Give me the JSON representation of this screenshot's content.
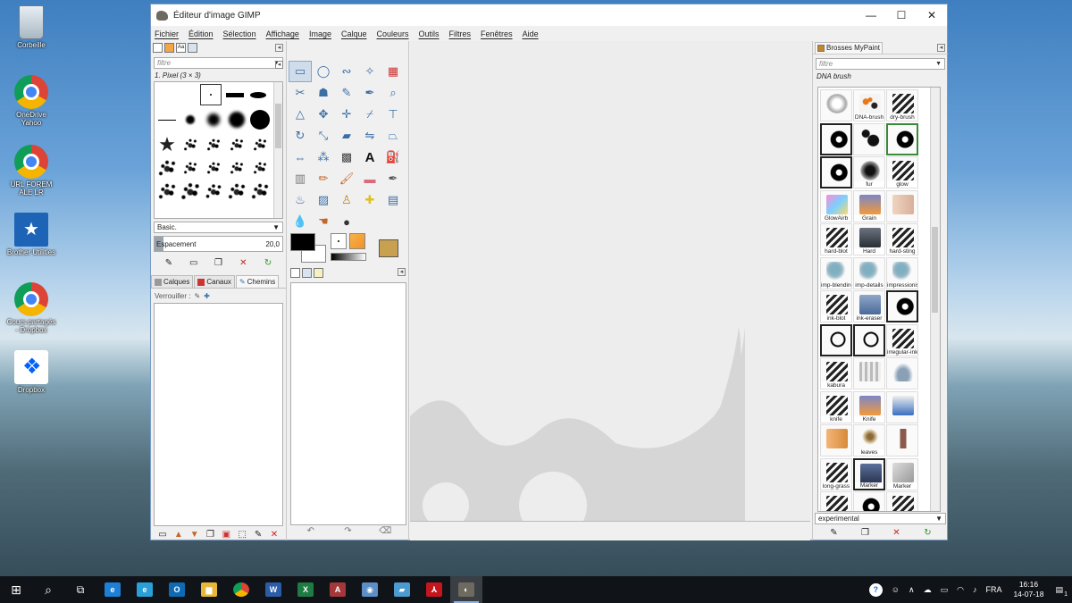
{
  "desktop": {
    "icons": [
      {
        "label": "Corbeille",
        "icon": "recycle-bin-icon"
      },
      {
        "label": "OneDrive Yahoo",
        "icon": "chrome-icon"
      },
      {
        "label": "URL FOREM ALE LR",
        "icon": "chrome-icon"
      },
      {
        "label": "Brother Utilities",
        "icon": "brother-icon"
      },
      {
        "label": "Cours partagés - Dropbox",
        "icon": "chrome-icon"
      },
      {
        "label": "Dropbox",
        "icon": "dropbox-icon"
      }
    ]
  },
  "window": {
    "title": "Éditeur d'image GIMP",
    "minimize": "—",
    "maximize": "☐",
    "close": "✕"
  },
  "menu": [
    "Fichier",
    "Édition",
    "Sélection",
    "Affichage",
    "Image",
    "Calque",
    "Couleurs",
    "Outils",
    "Filtres",
    "Fenêtres",
    "Aide"
  ],
  "brushes_panel": {
    "filter_placeholder": "filtre",
    "current_brush": "1. Pixel (3 × 3)",
    "preset": "Basic.",
    "spacing_label": "Espacement",
    "spacing_value": "20,0",
    "spacing_fraction": 0.07
  },
  "layers_panel": {
    "tabs": [
      "Calques",
      "Canaux",
      "Chemins"
    ],
    "lock_label": "Verrouiller :"
  },
  "mypaint_panel": {
    "tab_label": "Brosses MyPaint",
    "filter_placeholder": "filtre",
    "current_brush": "DNA brush",
    "tag": "experimental",
    "brushes": [
      {
        "label": "",
        "style": "swirl-gray"
      },
      {
        "label": "DNA-brush",
        "style": "dna"
      },
      {
        "label": "dry-brush",
        "style": "scribble"
      },
      {
        "label": "",
        "style": "swirl-black"
      },
      {
        "label": "",
        "style": "blobs"
      },
      {
        "label": "",
        "style": "swirl-black"
      },
      {
        "label": "",
        "style": "swirl-black"
      },
      {
        "label": "fur",
        "style": "fuzzy"
      },
      {
        "label": "glow",
        "style": "scribble"
      },
      {
        "label": "GlowAirb",
        "style": "glow"
      },
      {
        "label": "Grain",
        "style": "blend-grain"
      },
      {
        "label": "",
        "style": "finger"
      },
      {
        "label": "hard-blot",
        "style": "scribble"
      },
      {
        "label": "Hard",
        "style": "eraser-hard"
      },
      {
        "label": "hard-sting",
        "style": "scribble"
      },
      {
        "label": "imp-blending",
        "style": "teal"
      },
      {
        "label": "imp-details",
        "style": "teal"
      },
      {
        "label": "impressionism",
        "style": "teal"
      },
      {
        "label": "ink-blot",
        "style": "scribble"
      },
      {
        "label": "ink-eraser",
        "style": "eraser-ink"
      },
      {
        "label": "",
        "style": "swirl-black"
      },
      {
        "label": "",
        "style": "swirl-thin"
      },
      {
        "label": "",
        "style": "swirl-thin"
      },
      {
        "label": "irregular-ink",
        "style": "scribble"
      },
      {
        "label": "kabura",
        "style": "scribble"
      },
      {
        "label": "",
        "style": "pencils"
      },
      {
        "label": "",
        "style": "drop"
      },
      {
        "label": "knife",
        "style": "scribble"
      },
      {
        "label": "Knife",
        "style": "blend-knife"
      },
      {
        "label": "",
        "style": "blue-tool"
      },
      {
        "label": "",
        "style": "orange-stroke"
      },
      {
        "label": "leaves",
        "style": "tree"
      },
      {
        "label": "",
        "style": "bottle"
      },
      {
        "label": "long-grass",
        "style": "scribble"
      },
      {
        "label": "Marker",
        "style": "ink-marker"
      },
      {
        "label": "Marker",
        "style": "marker-hand"
      },
      {
        "label": "",
        "style": "scribble"
      },
      {
        "label": "",
        "style": "swirl-black"
      },
      {
        "label": "",
        "style": "scribble"
      }
    ]
  },
  "taskbar": {
    "apps": [
      {
        "name": "edge",
        "glyph": "e",
        "color": "#1e7fd6"
      },
      {
        "name": "internet-explorer",
        "glyph": "e",
        "color": "#2a9fd8"
      },
      {
        "name": "outlook",
        "glyph": "O",
        "color": "#0f6ab4"
      },
      {
        "name": "file-explorer",
        "glyph": "▆",
        "color": "#e8b73a"
      },
      {
        "name": "chrome",
        "glyph": "",
        "color": "#db4437"
      },
      {
        "name": "word",
        "glyph": "W",
        "color": "#2b5ca8"
      },
      {
        "name": "excel",
        "glyph": "X",
        "color": "#1f7a44"
      },
      {
        "name": "access",
        "glyph": "A",
        "color": "#a4373a"
      },
      {
        "name": "app-generic",
        "glyph": "◉",
        "color": "#5c8fc7"
      },
      {
        "name": "app-blue",
        "glyph": "▰",
        "color": "#4b9ad0"
      },
      {
        "name": "acrobat",
        "glyph": "⅄",
        "color": "#c4161c"
      },
      {
        "name": "gimp",
        "glyph": "◐",
        "color": "#6f6a60"
      }
    ],
    "language": "FRA",
    "time": "16:16",
    "date": "14-07-18",
    "notification_count": "1"
  }
}
